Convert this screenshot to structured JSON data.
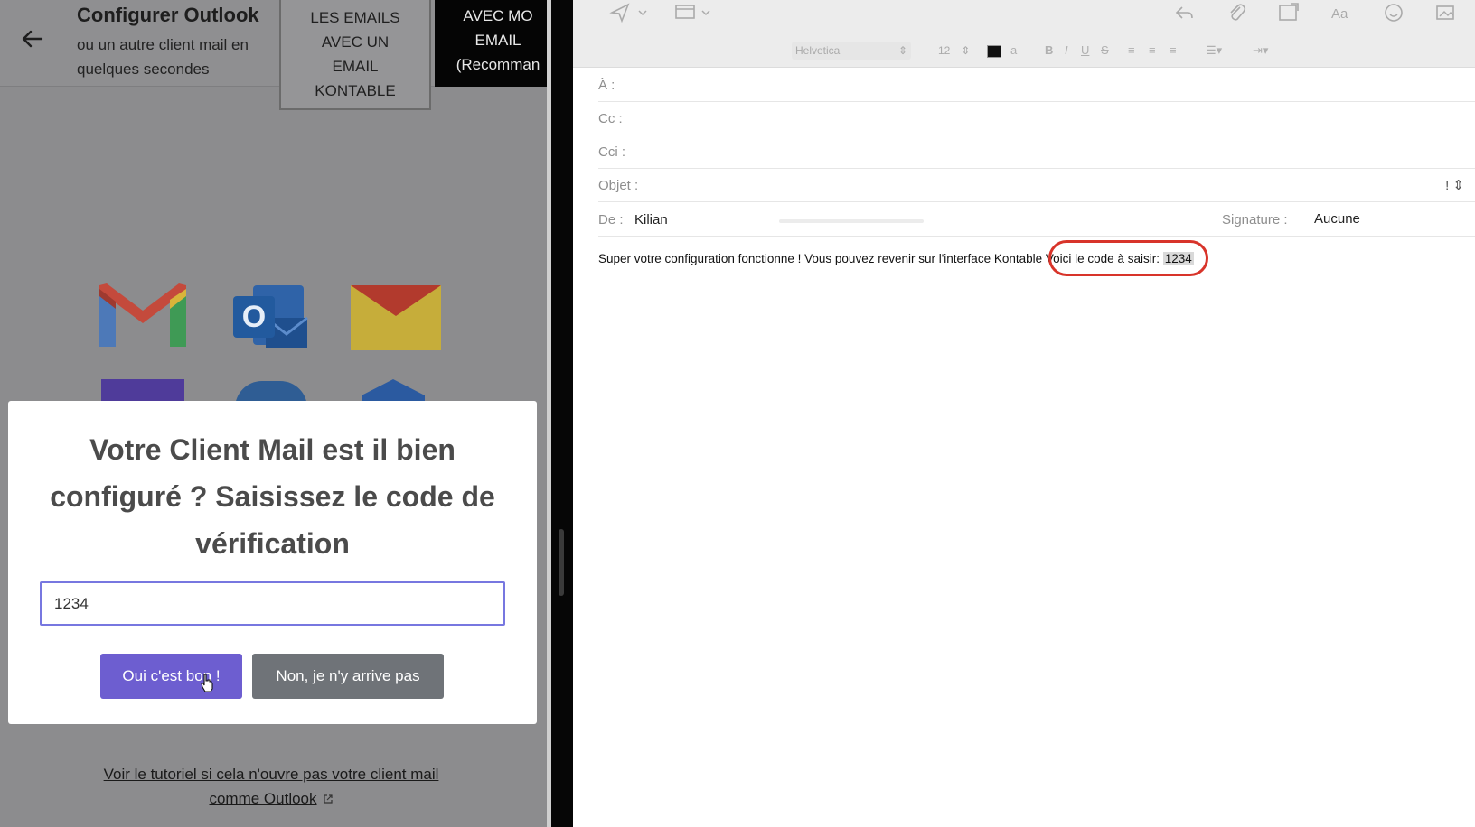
{
  "left": {
    "header": {
      "title": "Configurer Outlook",
      "subtitle": "ou un autre client mail en quelques secondes"
    },
    "tabs": {
      "emails_lines": [
        "LES EMAILS",
        "AVEC UN",
        "EMAIL",
        "KONTABLE"
      ],
      "avec_lines": [
        "AVEC MO",
        "EMAIL",
        "(Recomman"
      ]
    },
    "modal": {
      "question": "Votre Client Mail est il bien configuré ? Saisissez le code de vérification",
      "code_value": "1234",
      "yes_label": "Oui c'est bon !",
      "no_label": "Non, je n'y arrive pas"
    },
    "tutorial_link": "Voir le tutoriel si cela n'ouvre pas votre client mail comme Outlook"
  },
  "mail": {
    "toolbar": {
      "font": "Helvetica",
      "size": "12"
    },
    "to_label": "À :",
    "cc_label": "Cc :",
    "bcc_label": "Cci :",
    "subject_label": "Objet :",
    "priority": "!",
    "from_label": "De :",
    "from_value": "Kilian",
    "signature_label": "Signature :",
    "signature_value": "Aucune",
    "body_prefix": "Super votre configuration fonctionne ! Vous pouvez revenir sur l'interface Kontable",
    "body_code_text": "Voici le code à saisir: ",
    "body_code": "1234"
  },
  "colors": {
    "primary_button": "#6d5ed0",
    "secondary_button": "#6f7378",
    "highlight_circle": "#d8342a"
  }
}
